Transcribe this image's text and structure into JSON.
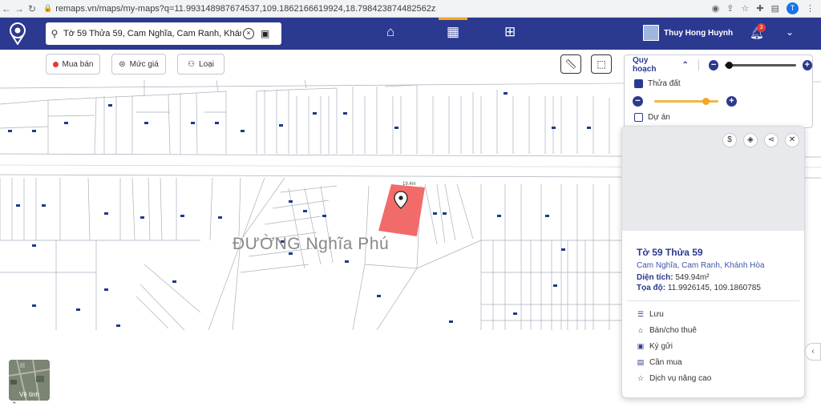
{
  "browser": {
    "url": "remaps.vn/maps/my-maps?q=11.993148987674537,109.1862166619924,18.798423874482562z",
    "profile_initial": "T"
  },
  "header": {
    "search_value": "Tờ 59 Thửa 59, Cam Nghĩa, Cam Ranh, Khánh Hòa",
    "user_name": "Thuy Hong Huynh",
    "notification_count": "3",
    "accent_color": "#2b3990",
    "active_tab_color": "#f5a623"
  },
  "filters": {
    "buy_sell": "Mua bán",
    "price": "Mức giá",
    "type": "Loại"
  },
  "layers": {
    "title": "Quy hoạch",
    "parcel_label": "Thửa đất",
    "project_label": "Dự án",
    "zoom_level": 0.05,
    "opacity_level": 0.8
  },
  "map": {
    "street_name": "ĐƯỜNG Nghĩa Phú",
    "parcel_color": "#f26b6b",
    "satellite_label": "Vệ tinh"
  },
  "card": {
    "title": "Tờ 59 Thửa 59",
    "address": "Cam Nghĩa, Cam Ranh, Khánh Hòa",
    "area_label": "Diện tích:",
    "area_value": "549.94m²",
    "coord_label": "Tọa độ:",
    "coord_value": "11.9926145, 109.1860785",
    "menu": [
      {
        "icon": "list-icon",
        "label": "Lưu"
      },
      {
        "icon": "house-icon",
        "label": "Bán/cho thuê"
      },
      {
        "icon": "deposit-icon",
        "label": "Ký gửi"
      },
      {
        "icon": "clipboard-icon",
        "label": "Cần mua"
      },
      {
        "icon": "star-icon",
        "label": "Dịch vụ nâng cao"
      }
    ]
  }
}
